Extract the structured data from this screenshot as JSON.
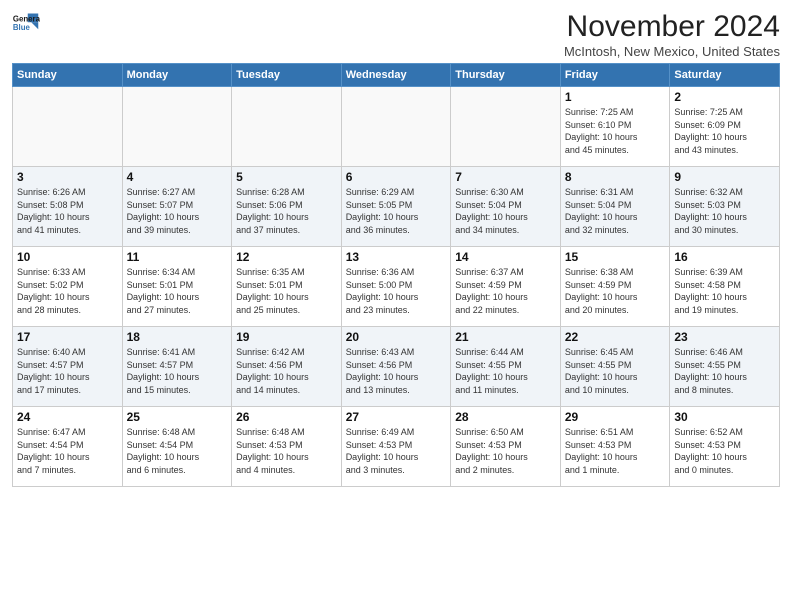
{
  "header": {
    "logo_line1": "General",
    "logo_line2": "Blue",
    "title": "November 2024",
    "location": "McIntosh, New Mexico, United States"
  },
  "weekdays": [
    "Sunday",
    "Monday",
    "Tuesday",
    "Wednesday",
    "Thursday",
    "Friday",
    "Saturday"
  ],
  "weeks": [
    [
      {
        "day": "",
        "info": ""
      },
      {
        "day": "",
        "info": ""
      },
      {
        "day": "",
        "info": ""
      },
      {
        "day": "",
        "info": ""
      },
      {
        "day": "",
        "info": ""
      },
      {
        "day": "1",
        "info": "Sunrise: 7:25 AM\nSunset: 6:10 PM\nDaylight: 10 hours\nand 45 minutes."
      },
      {
        "day": "2",
        "info": "Sunrise: 7:25 AM\nSunset: 6:09 PM\nDaylight: 10 hours\nand 43 minutes."
      }
    ],
    [
      {
        "day": "3",
        "info": "Sunrise: 6:26 AM\nSunset: 5:08 PM\nDaylight: 10 hours\nand 41 minutes."
      },
      {
        "day": "4",
        "info": "Sunrise: 6:27 AM\nSunset: 5:07 PM\nDaylight: 10 hours\nand 39 minutes."
      },
      {
        "day": "5",
        "info": "Sunrise: 6:28 AM\nSunset: 5:06 PM\nDaylight: 10 hours\nand 37 minutes."
      },
      {
        "day": "6",
        "info": "Sunrise: 6:29 AM\nSunset: 5:05 PM\nDaylight: 10 hours\nand 36 minutes."
      },
      {
        "day": "7",
        "info": "Sunrise: 6:30 AM\nSunset: 5:04 PM\nDaylight: 10 hours\nand 34 minutes."
      },
      {
        "day": "8",
        "info": "Sunrise: 6:31 AM\nSunset: 5:04 PM\nDaylight: 10 hours\nand 32 minutes."
      },
      {
        "day": "9",
        "info": "Sunrise: 6:32 AM\nSunset: 5:03 PM\nDaylight: 10 hours\nand 30 minutes."
      }
    ],
    [
      {
        "day": "10",
        "info": "Sunrise: 6:33 AM\nSunset: 5:02 PM\nDaylight: 10 hours\nand 28 minutes."
      },
      {
        "day": "11",
        "info": "Sunrise: 6:34 AM\nSunset: 5:01 PM\nDaylight: 10 hours\nand 27 minutes."
      },
      {
        "day": "12",
        "info": "Sunrise: 6:35 AM\nSunset: 5:01 PM\nDaylight: 10 hours\nand 25 minutes."
      },
      {
        "day": "13",
        "info": "Sunrise: 6:36 AM\nSunset: 5:00 PM\nDaylight: 10 hours\nand 23 minutes."
      },
      {
        "day": "14",
        "info": "Sunrise: 6:37 AM\nSunset: 4:59 PM\nDaylight: 10 hours\nand 22 minutes."
      },
      {
        "day": "15",
        "info": "Sunrise: 6:38 AM\nSunset: 4:59 PM\nDaylight: 10 hours\nand 20 minutes."
      },
      {
        "day": "16",
        "info": "Sunrise: 6:39 AM\nSunset: 4:58 PM\nDaylight: 10 hours\nand 19 minutes."
      }
    ],
    [
      {
        "day": "17",
        "info": "Sunrise: 6:40 AM\nSunset: 4:57 PM\nDaylight: 10 hours\nand 17 minutes."
      },
      {
        "day": "18",
        "info": "Sunrise: 6:41 AM\nSunset: 4:57 PM\nDaylight: 10 hours\nand 15 minutes."
      },
      {
        "day": "19",
        "info": "Sunrise: 6:42 AM\nSunset: 4:56 PM\nDaylight: 10 hours\nand 14 minutes."
      },
      {
        "day": "20",
        "info": "Sunrise: 6:43 AM\nSunset: 4:56 PM\nDaylight: 10 hours\nand 13 minutes."
      },
      {
        "day": "21",
        "info": "Sunrise: 6:44 AM\nSunset: 4:55 PM\nDaylight: 10 hours\nand 11 minutes."
      },
      {
        "day": "22",
        "info": "Sunrise: 6:45 AM\nSunset: 4:55 PM\nDaylight: 10 hours\nand 10 minutes."
      },
      {
        "day": "23",
        "info": "Sunrise: 6:46 AM\nSunset: 4:55 PM\nDaylight: 10 hours\nand 8 minutes."
      }
    ],
    [
      {
        "day": "24",
        "info": "Sunrise: 6:47 AM\nSunset: 4:54 PM\nDaylight: 10 hours\nand 7 minutes."
      },
      {
        "day": "25",
        "info": "Sunrise: 6:48 AM\nSunset: 4:54 PM\nDaylight: 10 hours\nand 6 minutes."
      },
      {
        "day": "26",
        "info": "Sunrise: 6:48 AM\nSunset: 4:53 PM\nDaylight: 10 hours\nand 4 minutes."
      },
      {
        "day": "27",
        "info": "Sunrise: 6:49 AM\nSunset: 4:53 PM\nDaylight: 10 hours\nand 3 minutes."
      },
      {
        "day": "28",
        "info": "Sunrise: 6:50 AM\nSunset: 4:53 PM\nDaylight: 10 hours\nand 2 minutes."
      },
      {
        "day": "29",
        "info": "Sunrise: 6:51 AM\nSunset: 4:53 PM\nDaylight: 10 hours\nand 1 minute."
      },
      {
        "day": "30",
        "info": "Sunrise: 6:52 AM\nSunset: 4:53 PM\nDaylight: 10 hours\nand 0 minutes."
      }
    ]
  ]
}
